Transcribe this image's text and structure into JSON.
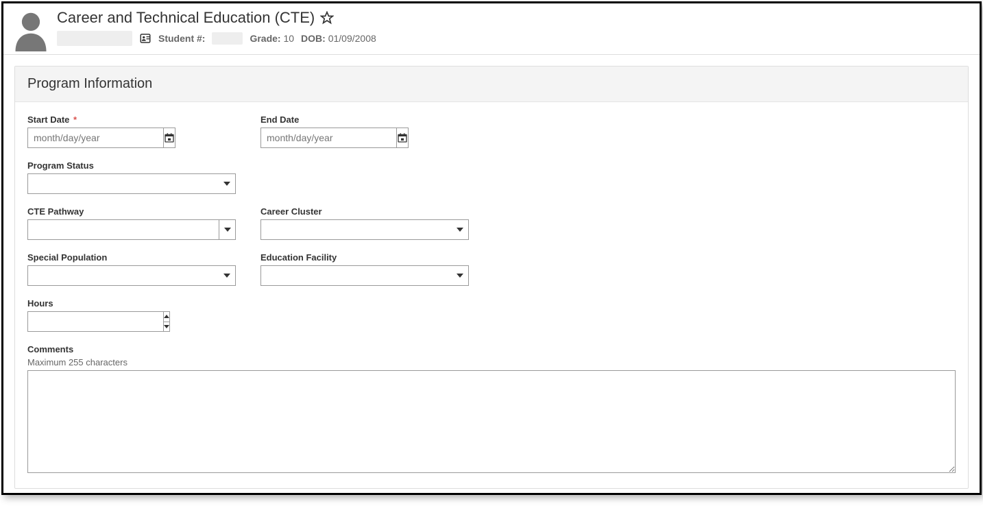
{
  "header": {
    "page_title": "Career and Technical Education (CTE)",
    "student_number_label": "Student #:",
    "grade_label": "Grade:",
    "grade_value": "10",
    "dob_label": "DOB:",
    "dob_value": "01/09/2008"
  },
  "panel": {
    "title": "Program Information"
  },
  "fields": {
    "start_date": {
      "label": "Start Date",
      "required": "*",
      "placeholder": "month/day/year",
      "value": ""
    },
    "end_date": {
      "label": "End Date",
      "placeholder": "month/day/year",
      "value": ""
    },
    "program_status": {
      "label": "Program Status",
      "value": ""
    },
    "cte_pathway": {
      "label": "CTE Pathway",
      "value": ""
    },
    "career_cluster": {
      "label": "Career Cluster",
      "value": ""
    },
    "special_population": {
      "label": "Special Population",
      "value": ""
    },
    "education_facility": {
      "label": "Education Facility",
      "value": ""
    },
    "hours": {
      "label": "Hours",
      "value": ""
    },
    "comments": {
      "label": "Comments",
      "hint": "Maximum 255 characters",
      "value": ""
    }
  }
}
